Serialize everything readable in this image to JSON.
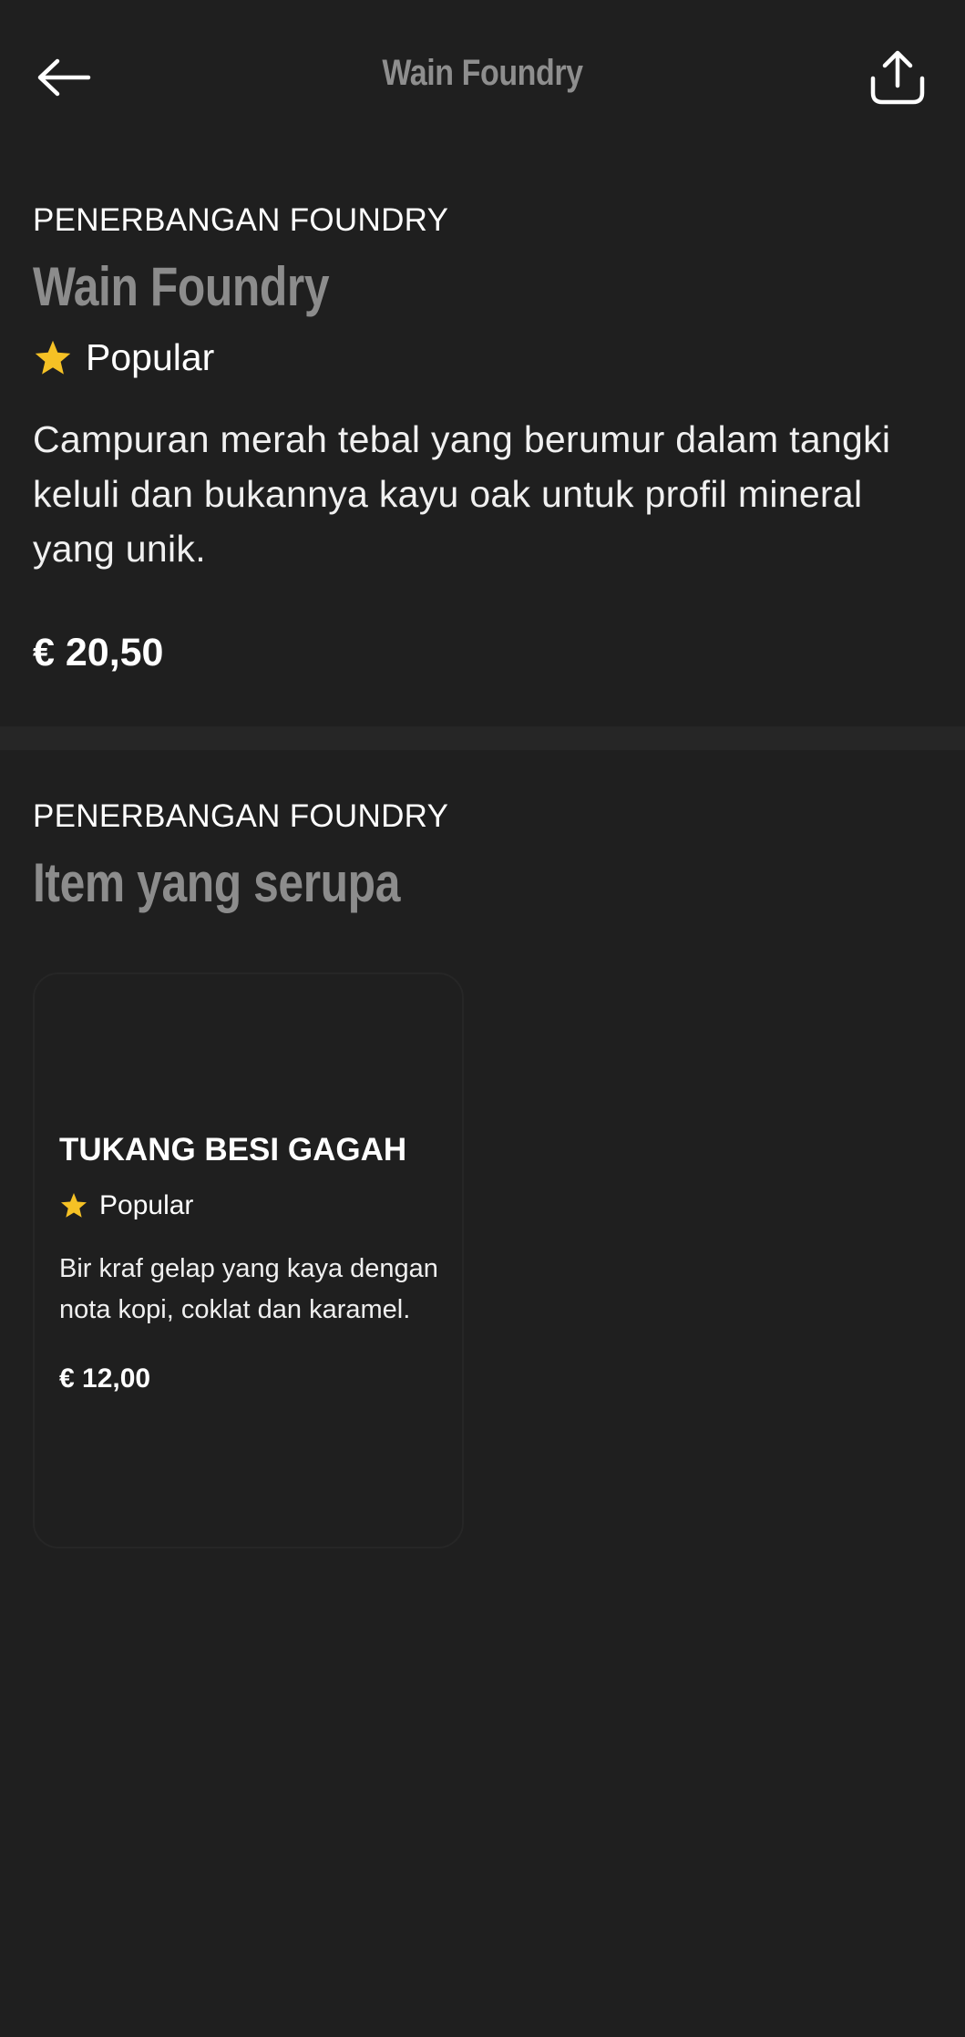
{
  "header": {
    "title": "Wain Foundry",
    "back_icon": "arrow-left-icon",
    "share_icon": "share-icon"
  },
  "item": {
    "category": "PENERBANGAN FOUNDRY",
    "name": "Wain Foundry",
    "badge": "Popular",
    "description": "Campuran merah tebal yang berumur dalam tangki keluli dan bukannya kayu oak untuk profil mineral yang unik.",
    "price": "€ 20,50"
  },
  "similar": {
    "category": "PENERBANGAN FOUNDRY",
    "heading": "Item yang serupa",
    "items": [
      {
        "name": "TUKANG BESI GAGAH",
        "badge": "Popular",
        "description": "Bir kraf gelap yang kaya dengan nota kopi, coklat dan karamel.",
        "price": "€ 12,00"
      }
    ]
  },
  "colors": {
    "background": "#1f1f1f",
    "star": "#f5c125",
    "muted_title": "#8c8c8c"
  }
}
